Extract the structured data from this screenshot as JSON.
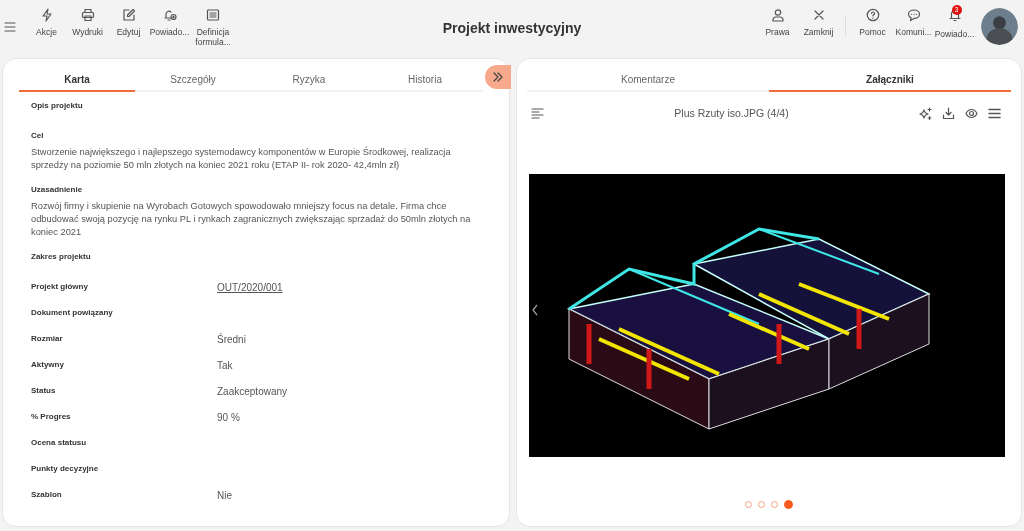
{
  "toolbar": {
    "left_actions": [
      {
        "kind": "bolt",
        "label": "Akcje"
      },
      {
        "kind": "printer",
        "label": "Wydruki"
      },
      {
        "kind": "edit",
        "label": "Edytuj"
      },
      {
        "kind": "bell-plus",
        "label": "Powiado..."
      },
      {
        "kind": "form",
        "label": "Definicja formula..."
      }
    ],
    "title": "Projekt inwestycyjny",
    "right_actions": [
      {
        "kind": "person",
        "label": "Prawa"
      },
      {
        "kind": "close",
        "label": "Zamknij"
      },
      {
        "kind": "divider"
      },
      {
        "kind": "help",
        "label": "Pomoc"
      },
      {
        "kind": "chat",
        "label": "Komuni..."
      },
      {
        "kind": "bell",
        "label": "Powiado...",
        "badge": "3"
      }
    ]
  },
  "left_panel": {
    "tabs": [
      {
        "label": "Karta",
        "selected": true
      },
      {
        "label": "Szczegóły",
        "selected": false
      },
      {
        "label": "Ryzyka",
        "selected": false
      },
      {
        "label": "Historia",
        "selected": false
      }
    ],
    "fields": [
      {
        "kind": "heading",
        "label": "Opis projektu"
      },
      {
        "kind": "paragraph",
        "label": "Cel",
        "value": "Stworzenie największego i najlepszego systemodawcy komponentów w Europie Środkowej, realizacja sprzedży na poziomie 50 mln złotych na koniec 2021 roku  (ETAP II- rok 2020- 42,4mln zł)"
      },
      {
        "kind": "paragraph",
        "label": "Uzasadnienie",
        "value": "Rozwój firmy i skupienie na Wyrobach Gotowych spowodowało mniejszy focus na detale.  Firma chce odbudować swoją pozycję na rynku PL i rynkach zagranicznych zwiększając sprzadaż do 50mln złotych na koniec 2021"
      },
      {
        "kind": "heading",
        "label": "Zakres projektu"
      },
      {
        "kind": "link",
        "label": "Projekt główny",
        "value": "OUT/2020/001"
      },
      {
        "kind": "row",
        "label": "Dokument powiązany"
      },
      {
        "kind": "row",
        "label": "Rozmiar",
        "value": "Średni"
      },
      {
        "kind": "row",
        "label": "Aktywny",
        "value": "Tak"
      },
      {
        "kind": "row",
        "label": "Status",
        "value": "Zaakceptowany"
      },
      {
        "kind": "row",
        "label": "% Progres",
        "value": "90 %"
      },
      {
        "kind": "row",
        "label": "Ocena statusu"
      },
      {
        "kind": "row",
        "label": "Punkty decyzyjne"
      },
      {
        "kind": "row",
        "label": "Szablon",
        "value": "Nie"
      }
    ]
  },
  "right_panel": {
    "tabs": [
      {
        "label": "Komentarze",
        "selected": false
      },
      {
        "label": "Załączniki",
        "selected": true
      }
    ],
    "file_title": "Plus Rzuty iso.JPG (4/4)",
    "pages": [
      {
        "selected": false
      },
      {
        "selected": false
      },
      {
        "selected": false
      },
      {
        "selected": true
      }
    ]
  }
}
